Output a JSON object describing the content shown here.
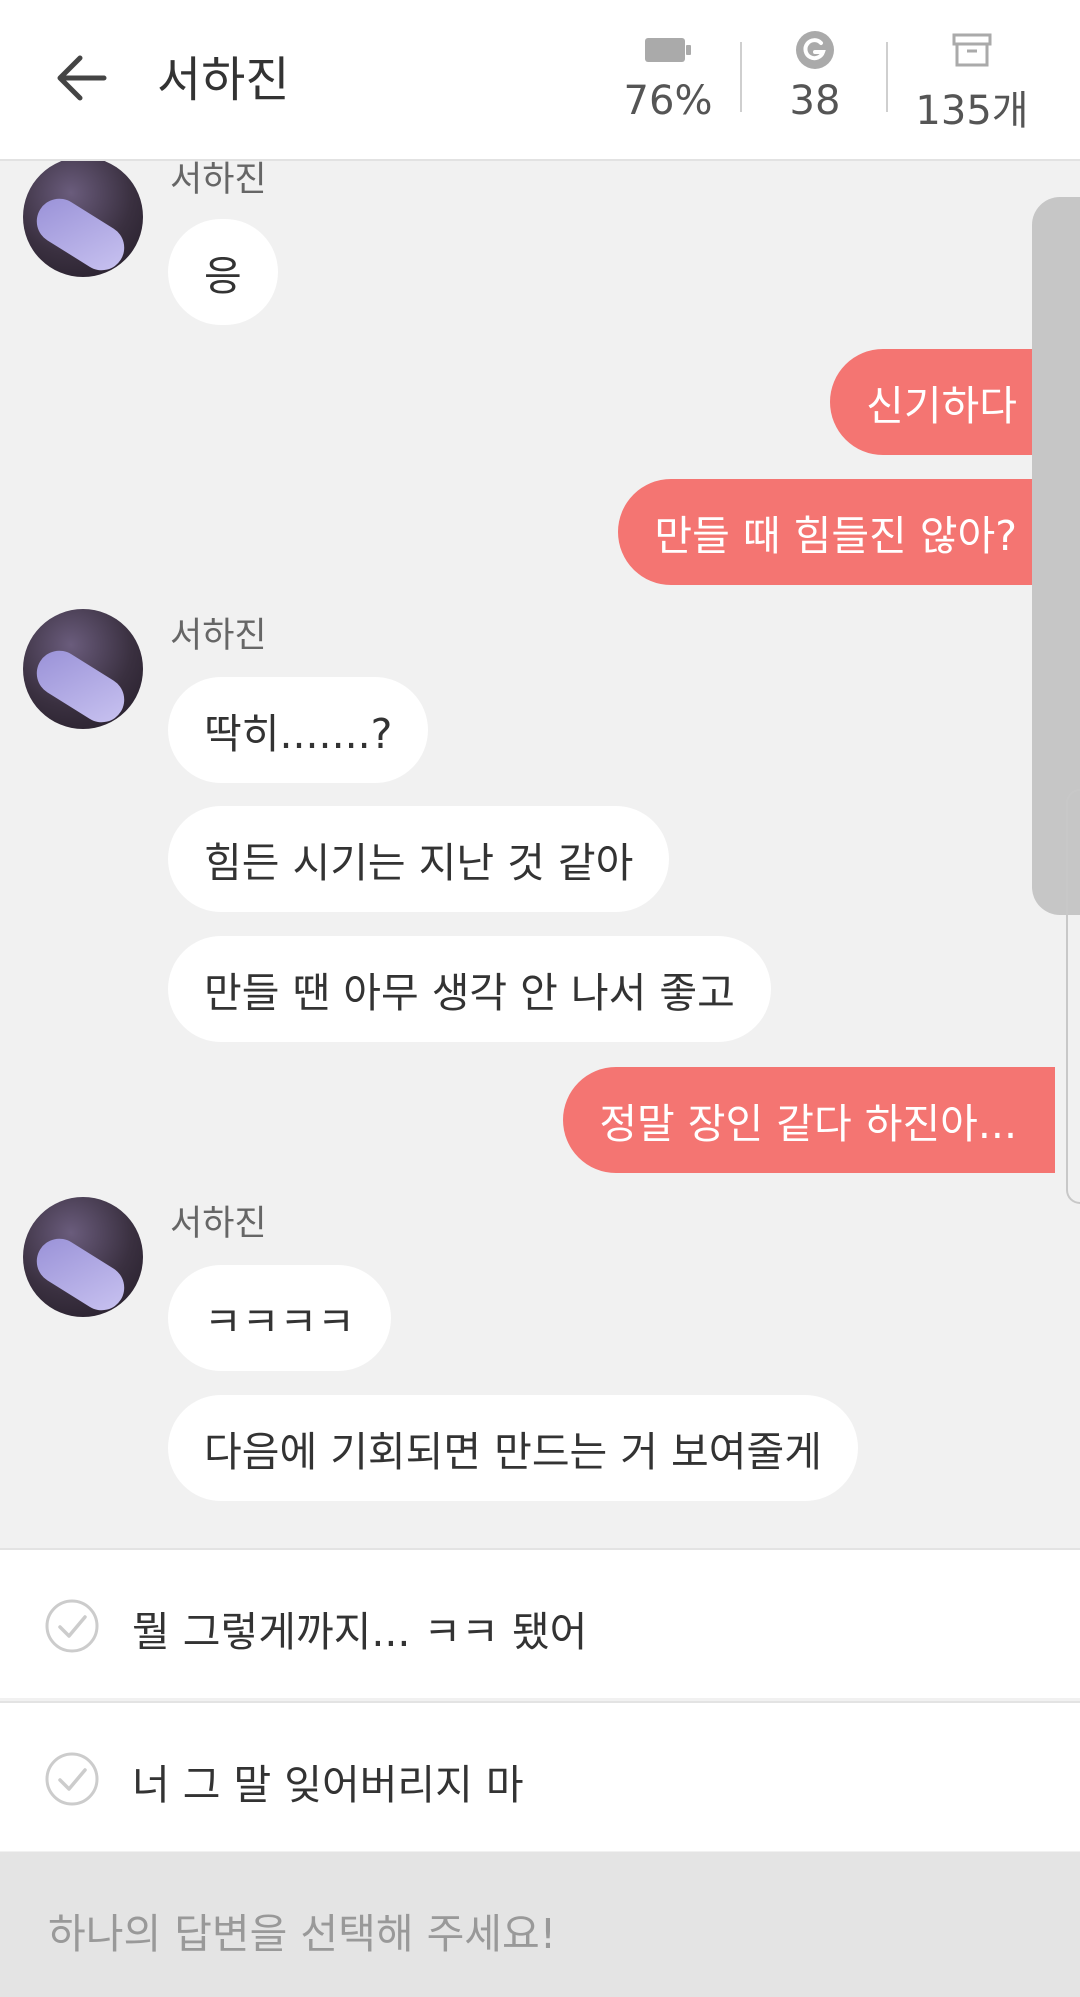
{
  "header": {
    "title": "서하진",
    "battery": "76%",
    "coins": "38",
    "storage": "135개"
  },
  "chat": {
    "sender_name": "서하진",
    "messages": [
      {
        "from": "them",
        "text": "응"
      },
      {
        "from": "me",
        "text": "신기하다"
      },
      {
        "from": "me",
        "text": "만들 때 힘들진 않아?"
      },
      {
        "from": "them",
        "text": "딱히.......?"
      },
      {
        "from": "them",
        "text": "힘든 시기는 지난 것 같아"
      },
      {
        "from": "them",
        "text": "만들 땐 아무 생각 안 나서 좋고"
      },
      {
        "from": "me",
        "text": "정말 장인 같다 하진아..."
      },
      {
        "from": "them",
        "text": "ㅋㅋㅋㅋ"
      },
      {
        "from": "them",
        "text": "다음에 기회되면 만드는 거 보여줄게"
      }
    ]
  },
  "answers": [
    {
      "text": "뭘 그렇게까지... ㅋㅋ 됐어"
    },
    {
      "text": "너 그 말 잊어버리지 마"
    }
  ],
  "hint": "하나의 답변을 선택해 주세요!",
  "colors": {
    "my_bubble": "#f47572",
    "their_bubble": "#ffffff",
    "background": "#f1f1f1"
  },
  "icons": [
    "back-arrow-icon",
    "battery-icon",
    "coin-icon",
    "archive-box-icon",
    "avatar",
    "check-circle-icon"
  ]
}
